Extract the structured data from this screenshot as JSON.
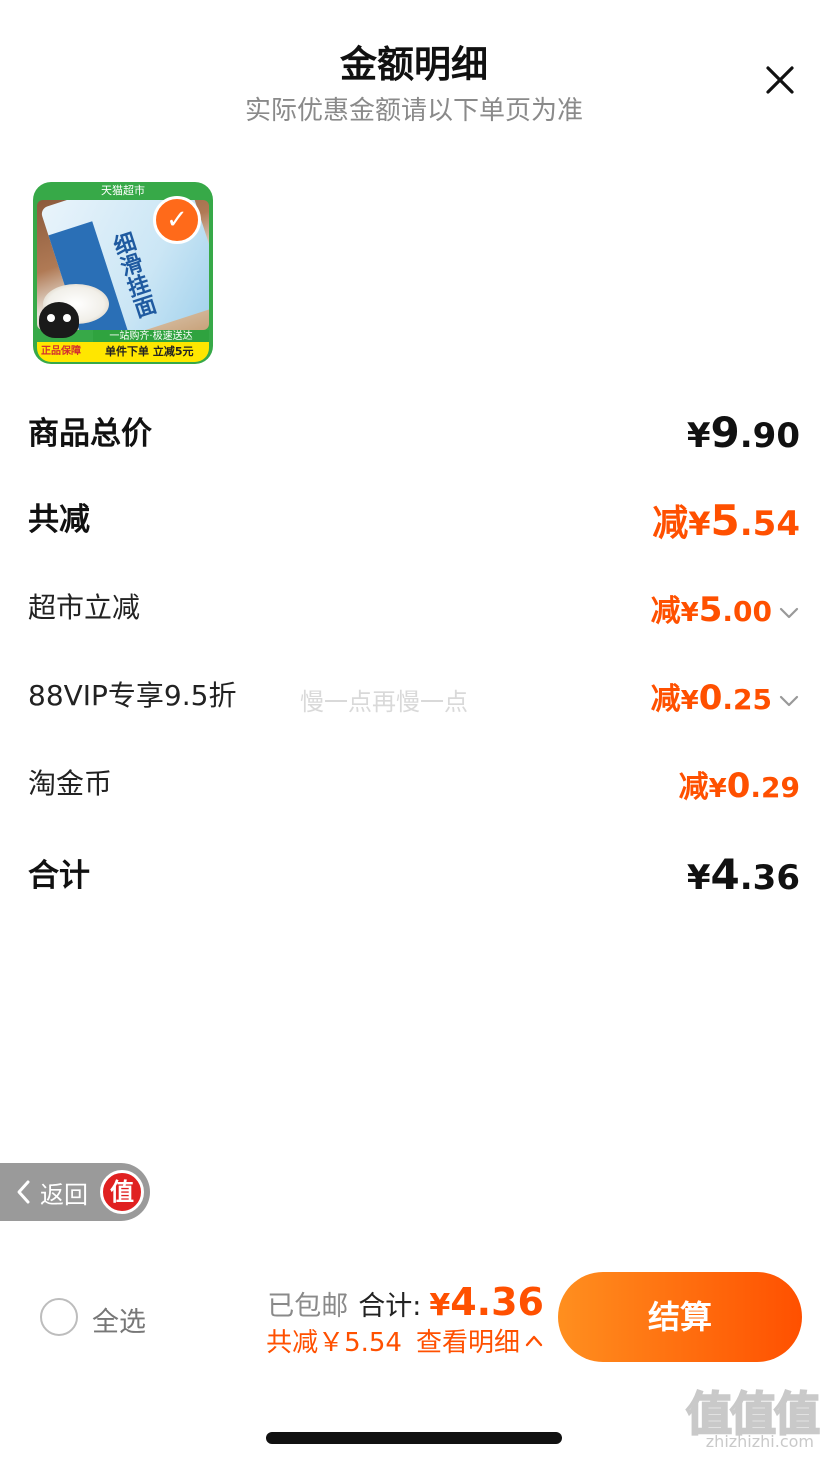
{
  "header": {
    "title": "金额明细",
    "subtitle": "实际优惠金额请以下单页为准"
  },
  "product": {
    "thumb_tag": "天猫超市",
    "pack_text": "细滑挂面",
    "strip_top": "一站购齐·极速送达",
    "strip_bottom_left": "正品保障",
    "strip_bottom": "单件下单 立减5元",
    "selected": true
  },
  "rows": {
    "subtotal": {
      "label": "商品总价",
      "yen": "¥",
      "int": "9",
      "dec": ".90"
    },
    "total_discount": {
      "label": "共减",
      "prefix": "减",
      "yen": "¥",
      "int": "5",
      "dec": ".54"
    },
    "supermarket_discount": {
      "label": "超市立减",
      "prefix": "减",
      "yen": "¥",
      "int": "5",
      "dec": ".00"
    },
    "vip_discount": {
      "label": "88VIP专享9.5折",
      "prefix": "减",
      "yen": "¥",
      "int": "0",
      "dec": ".25"
    },
    "coin_discount": {
      "label": "淘金币",
      "prefix": "减",
      "yen": "¥",
      "int": "0",
      "dec": ".29"
    },
    "total": {
      "label": "合计",
      "yen": "¥",
      "int": "4",
      "dec": ".36"
    }
  },
  "watermark_mid": "慢一点再慢一点",
  "back_pill": {
    "label": "返回",
    "badge": "值"
  },
  "footer": {
    "select_all": "全选",
    "shipping": "已包邮",
    "total_label": "合计:",
    "total_yen": "¥",
    "total_value": "4.36",
    "discount_text": "共减￥5.54",
    "view_detail": "查看明细",
    "checkout": "结算"
  },
  "corner_watermark": {
    "logo": "值值值",
    "url": "zhizhizhi.com"
  },
  "colors": {
    "accent": "#ff5000",
    "checkout_start": "#ff8f1f",
    "checkout_end": "#ff5000"
  }
}
